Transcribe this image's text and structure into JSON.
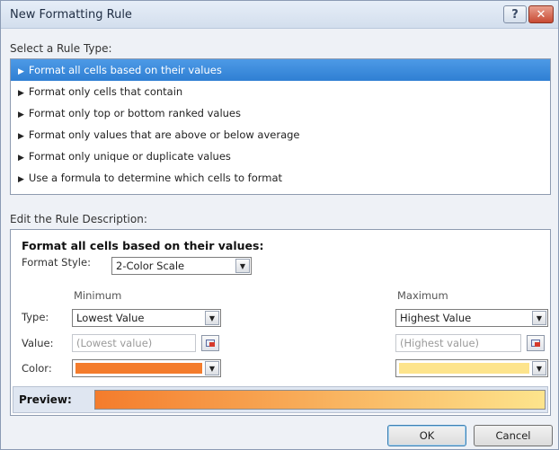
{
  "window": {
    "title": "New Formatting Rule"
  },
  "titlebar": {
    "help_glyph": "?",
    "close_glyph": "✕"
  },
  "rule_type": {
    "label": "Select a Rule Type:",
    "items": [
      {
        "label": "Format all cells based on their values",
        "selected": true
      },
      {
        "label": "Format only cells that contain",
        "selected": false
      },
      {
        "label": "Format only top or bottom ranked values",
        "selected": false
      },
      {
        "label": "Format only values that are above or below average",
        "selected": false
      },
      {
        "label": "Format only unique or duplicate values",
        "selected": false
      },
      {
        "label": "Use a formula to determine which cells to format",
        "selected": false
      }
    ]
  },
  "description": {
    "label": "Edit the Rule Description:",
    "section_title": "Format all cells based on their values:",
    "format_style_label": "Format Style:",
    "format_style_value": "2-Color Scale",
    "minimum_header": "Minimum",
    "maximum_header": "Maximum",
    "type_label": "Type:",
    "value_label": "Value:",
    "color_label": "Color:",
    "min_type": "Lowest Value",
    "max_type": "Highest Value",
    "min_value_placeholder": "(Lowest value)",
    "max_value_placeholder": "(Highest value)",
    "preview_label": "Preview:"
  },
  "colors": {
    "min_color": "#f47c2c",
    "max_color": "#fde48c",
    "selection": "#3a88dc"
  },
  "buttons": {
    "ok": "OK",
    "cancel": "Cancel"
  }
}
